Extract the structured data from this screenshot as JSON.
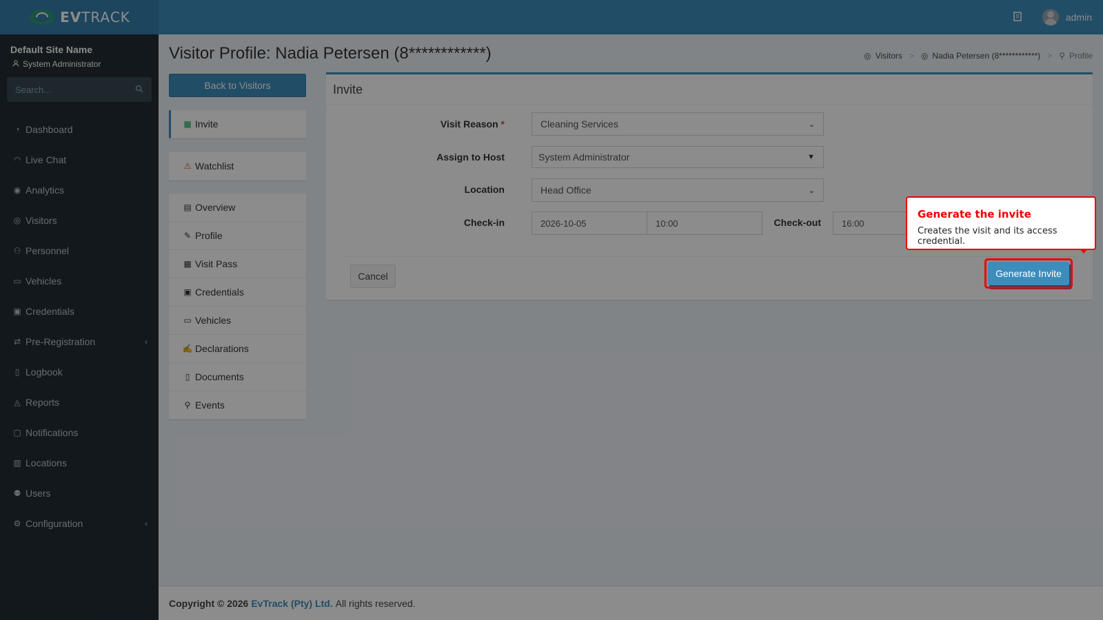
{
  "header": {
    "logo_text_bold": "EV",
    "logo_text_light": "TRACK",
    "username": "admin",
    "icons": [
      "building-icon",
      "user-avatar"
    ]
  },
  "sidebar": {
    "site_name": "Default Site Name",
    "user_role": "System Administrator",
    "search_placeholder": "Search...",
    "items": [
      {
        "label": "Dashboard",
        "icon": "dashboard-icon"
      },
      {
        "label": "Live Chat",
        "icon": "headset-icon"
      },
      {
        "label": "Analytics",
        "icon": "analytics-icon"
      },
      {
        "label": "Visitors",
        "icon": "eye-icon"
      },
      {
        "label": "Personnel",
        "icon": "users-icon"
      },
      {
        "label": "Vehicles",
        "icon": "car-icon"
      },
      {
        "label": "Credentials",
        "icon": "id-badge-icon"
      },
      {
        "label": "Pre-Registration",
        "icon": "exchange-icon"
      },
      {
        "label": "Logbook",
        "icon": "book-icon"
      },
      {
        "label": "Reports",
        "icon": "chart-icon"
      },
      {
        "label": "Notifications",
        "icon": "comments-icon"
      },
      {
        "label": "Locations",
        "icon": "building-icon"
      },
      {
        "label": "Users",
        "icon": "user-cog-icon"
      },
      {
        "label": "Configuration",
        "icon": "gear-icon"
      }
    ]
  },
  "page": {
    "title": "Visitor Profile: Nadia Petersen (8************)",
    "breadcrumb": [
      "Visitors",
      "Nadia Petersen (8************)",
      "Profile"
    ],
    "back_button": "Back to Visitors"
  },
  "profile_menu": {
    "invite": "Invite",
    "watchlist": "Watchlist",
    "items": [
      "Overview",
      "Profile",
      "Visit Pass",
      "Credentials",
      "Vehicles",
      "Declarations",
      "Documents",
      "Events"
    ]
  },
  "invite_form": {
    "title": "Invite",
    "visit_reason_label": "Visit Reason",
    "required_mark": "*",
    "visit_reason_value": "Cleaning Services",
    "host_label": "Assign to Host",
    "host_value": "System Administrator",
    "location_label": "Location",
    "location_value": "Head Office",
    "checkin_label": "Check-in",
    "checkin_date": "2026-10-05",
    "checkin_time": "10:00",
    "checkout_label": "Check-out",
    "checkout_time": "16:00",
    "cancel_button": "Cancel",
    "generate_button": "Generate Invite"
  },
  "callout": {
    "title": "Generate the invite",
    "text": "Creates the visit and its access credential."
  },
  "footer": {
    "copyright": "Copyright © 2026",
    "company": "EvTrack (Pty) Ltd.",
    "rights": "All rights reserved."
  },
  "colors": {
    "primary": "#3c8dbc",
    "sidebar": "#222d32",
    "callout_accent": "#ee0000"
  }
}
